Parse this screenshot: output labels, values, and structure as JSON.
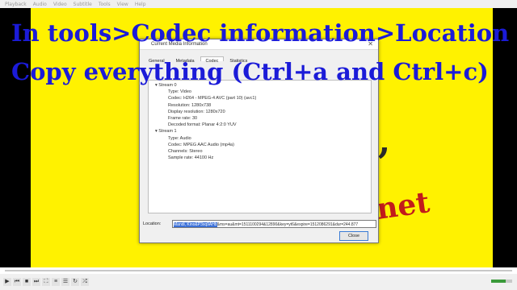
{
  "menu": [
    "Playback",
    "Audio",
    "Video",
    "Subtitle",
    "Tools",
    "View",
    "Help"
  ],
  "overlay": {
    "line1": "In tools>Codec information>Location",
    "line2": "Copy everything (Ctrl+a and Ctrl+c)"
  },
  "dialog": {
    "title": "Current Media Information",
    "tabs": [
      "General",
      "Metadata",
      "Codec",
      "Statistics"
    ],
    "active_tab": "Codec",
    "stream0": {
      "label": "Stream 0",
      "fields": [
        "Type: Video",
        "Codec: H264 - MPEG-4 AVC (part 10) (avc1)",
        "Resolution: 1280x738",
        "Display resolution: 1280x720",
        "Frame rate: 30",
        "Decoded format: Planar 4:2:0 YUV"
      ]
    },
    "stream1": {
      "label": "Stream 1",
      "fields": [
        "Type: Audio",
        "Codec: MPEG AAC Audio (mp4a)",
        "Channels: Stereo",
        "Sample rate: 44100 Hz"
      ]
    },
    "location_label": "Location:",
    "location_selected": "Mandi, Kino&P3xq9AHb",
    "location_value": "&ms=au&mt=1511100294&12890&key=yt6&expire=1512086291&dur=244.877",
    "close_label": "Close"
  },
  "player": {
    "progress": 0.0
  }
}
